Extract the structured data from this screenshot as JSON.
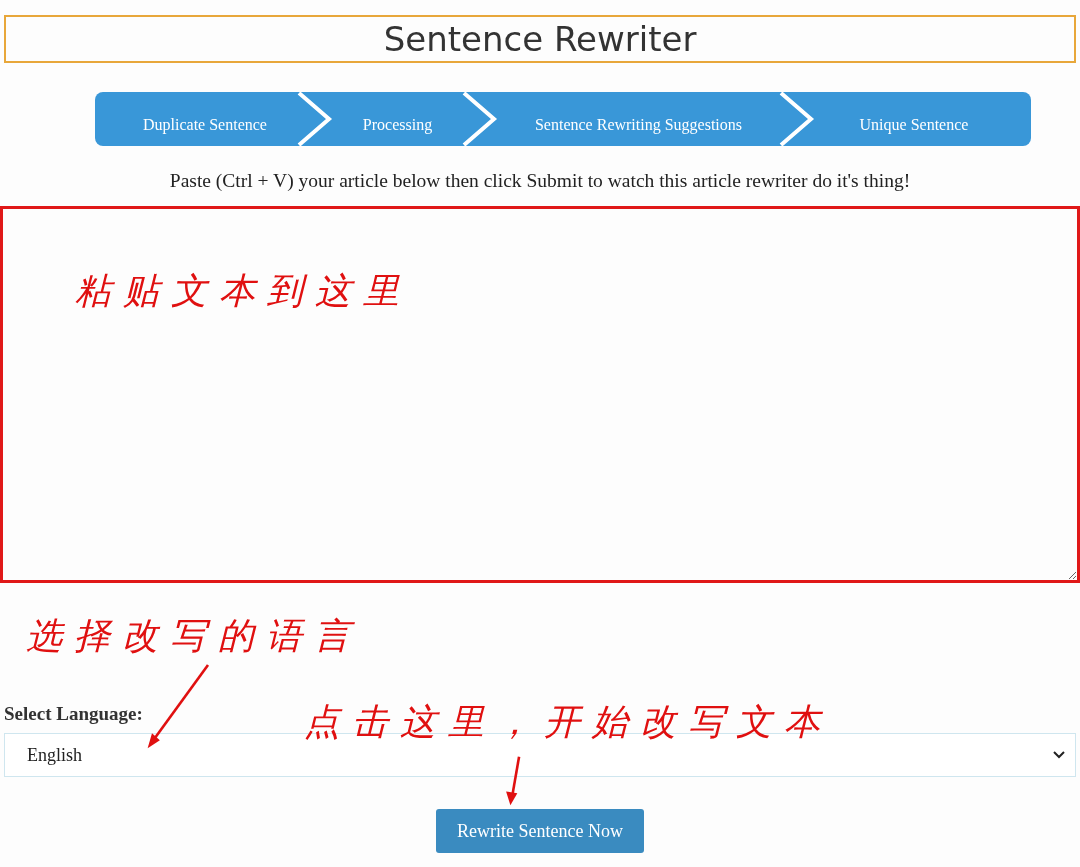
{
  "title": "Sentence Rewriter",
  "steps": [
    "Duplicate Sentence",
    "Processing",
    "Sentence Rewriting Suggestions",
    "Unique Sentence"
  ],
  "instruction": "Paste (Ctrl + V) your article below then click Submit to watch this article rewriter do it's thing!",
  "annotations": [
    "粘贴文本到这里",
    "选择改写的语言",
    "点击这里，开始改写文本"
  ],
  "language": {
    "label": "Select Language:",
    "value": "English"
  },
  "button": "Rewrite Sentence Now"
}
